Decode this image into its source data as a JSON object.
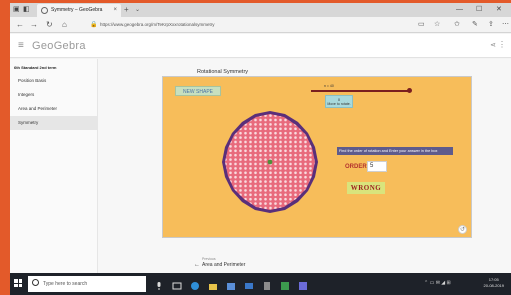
{
  "browser": {
    "tab_title": "Symmetry – GeoGebra",
    "tab_close": "×",
    "new_tab": "+",
    "url": "https://www.geogebra.org/m/TeKrpXxxrotationalsymmetry"
  },
  "app": {
    "brand": "GeoGebra"
  },
  "sidebar": {
    "book_title": "6th Standard 2nd term",
    "items": [
      {
        "label": "Position Basis"
      },
      {
        "label": "Integers"
      },
      {
        "label": "Area and Perimeter"
      },
      {
        "label": "Symmetry",
        "active": true
      }
    ]
  },
  "main": {
    "page_title": "Rotational Symmetry"
  },
  "applet": {
    "new_shape_label": "NEW SHAPE",
    "slider_label": "n = 40",
    "rotate_value": "0",
    "rotate_label": "Move to rotate.",
    "instruction": "Find the order of rotation and Enter your answer in the box",
    "order_label": "ORDER",
    "order_value": "5",
    "result_text": "WRONG",
    "reset_icon": "reset-icon"
  },
  "prev_nav": {
    "label": "Previous",
    "title": "Area and Perimeter"
  },
  "taskbar": {
    "search_placeholder": "Type here to search",
    "time": "17:05",
    "date": "20-08-2019"
  },
  "colors": {
    "background": "#e35a2a",
    "applet_bg": "#f7bd5a",
    "shape_fill": "#e86a7c",
    "shape_dark": "#5a2f7a",
    "wrong_bg": "#d9e47c",
    "wrong_text": "#9c1f1f",
    "instruction_bg": "#5e5b8c"
  }
}
